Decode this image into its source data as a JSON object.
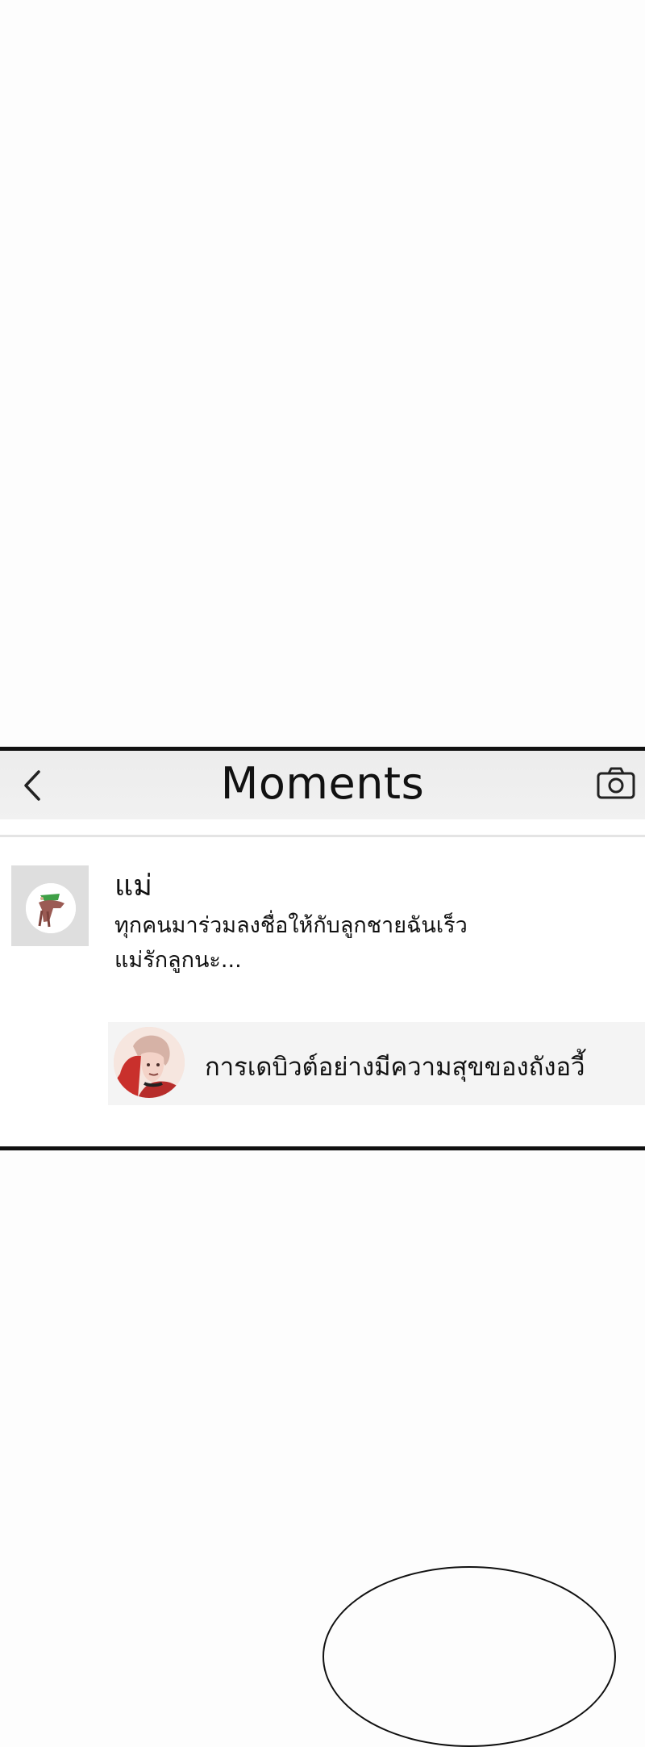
{
  "header": {
    "title": "Moments",
    "back_icon": "chevron-left-icon",
    "camera_icon": "camera-icon"
  },
  "post": {
    "author": "แม่",
    "text_line1": "ทุกคนมาร่วมลงชื่อให้กับลูกชายฉันเร็ว",
    "text_line2": "แม่รักลูกนะ...",
    "shared_card": {
      "title": "การเดบิวต์อย่างมีความสุขของถังอวี้"
    }
  }
}
